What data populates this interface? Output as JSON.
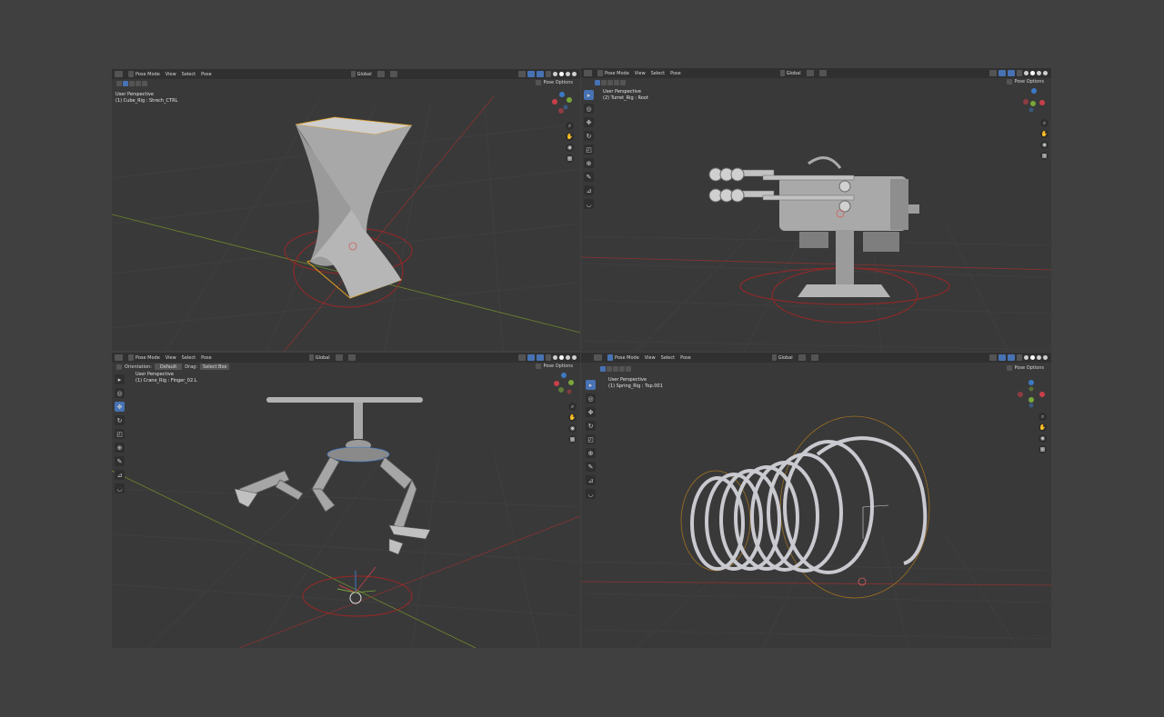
{
  "viewports": [
    {
      "header": {
        "mode": "Pose Mode",
        "menus": [
          "View",
          "Select",
          "Pose"
        ],
        "orientation": "Global"
      },
      "pose_options": "Pose Options",
      "info": {
        "perspective": "User Perspective",
        "object": "(1) Cube_Rig : Strech_CTRL"
      }
    },
    {
      "header": {
        "mode": "Pose Mode",
        "menus": [
          "View",
          "Select",
          "Pose"
        ],
        "orientation": "Global"
      },
      "pose_options": "Pose Options",
      "info": {
        "perspective": "User Perspective",
        "object": "(2) Turret_Rig : Root"
      }
    },
    {
      "header": {
        "mode": "Pose Mode",
        "menus": [
          "View",
          "Select",
          "Pose"
        ],
        "orientation": "Global"
      },
      "pose_options": "Pose Options",
      "subheader": {
        "orientation_label": "Orientation:",
        "orientation_value": "Default",
        "drag_label": "Drag:",
        "drag_value": "Select Box"
      },
      "info": {
        "perspective": "User Perspective",
        "object": "(1) Crane_Rig : Finger_02.L"
      }
    },
    {
      "header": {
        "mode": "Pose Mode",
        "menus": [
          "View",
          "Select",
          "Pose"
        ],
        "orientation": "Global"
      },
      "pose_options": "Pose Options",
      "info": {
        "perspective": "User Perspective",
        "object": "(1) Spring_Rig : Top.001"
      }
    }
  ],
  "icons": {
    "tools": [
      "cursor-icon",
      "3d-cursor-icon",
      "move-icon",
      "rotate-icon",
      "scale-icon",
      "transform-icon",
      "annotate-icon",
      "measure-icon",
      "relax-icon"
    ],
    "nav": [
      "zoom-icon",
      "pan-icon",
      "camera-icon",
      "grid-icon"
    ]
  },
  "colors": {
    "accent": "#4772b3",
    "viewport_bg": "#393939",
    "header_bg": "#303030",
    "page_bg": "#404040",
    "x_axis": "#c8404a",
    "y_axis": "#7aa63a",
    "z_axis": "#3d79c4"
  }
}
